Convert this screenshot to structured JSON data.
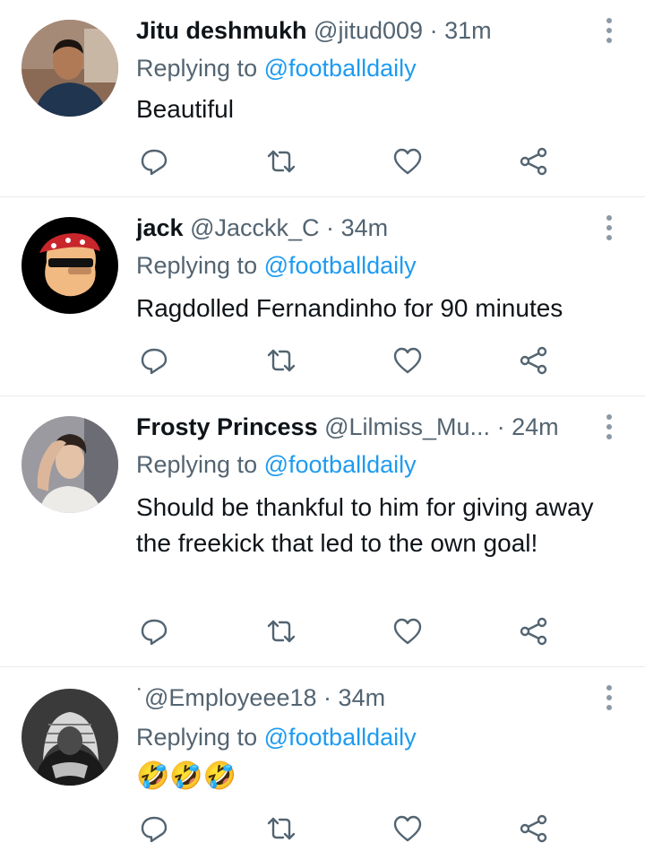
{
  "reply_prefix": "Replying to",
  "tweets": [
    {
      "name": "Jitu deshmukh",
      "handle": "@jitud009",
      "dot": "·",
      "time": "31m",
      "mention": "@footballdaily",
      "text": "Beautiful",
      "avatar": "avatar-photo-man-blue-shirt"
    },
    {
      "name": "jack",
      "handle": "@Jacckk_C",
      "dot": "·",
      "time": "34m",
      "mention": "@footballdaily",
      "text": "Ragdolled Fernandinho for 90 minutes",
      "avatar": "avatar-cartoon-pirate-sunglasses"
    },
    {
      "name": "Frosty Princess",
      "handle": "@Lilmiss_Mu...",
      "dot": "·",
      "time": "24m",
      "mention": "@footballdaily",
      "text": "Should be thankful to him for giving away the freekick that led to the own goal!",
      "avatar": "avatar-photo-person-hand-on-head"
    },
    {
      "name": "",
      "handle": "˙@Employeee18",
      "dot": "·",
      "time": "34m",
      "mention": "@footballdaily",
      "text": "🤣🤣🤣",
      "avatar": "avatar-photo-bw-man-headscarf"
    }
  ],
  "actions": [
    "reply-icon",
    "retweet-icon",
    "like-icon",
    "share-icon"
  ],
  "colors": {
    "link": "#1d9bf0",
    "secondary": "#536471",
    "text": "#0f1419",
    "divider": "#e6ecf0"
  }
}
